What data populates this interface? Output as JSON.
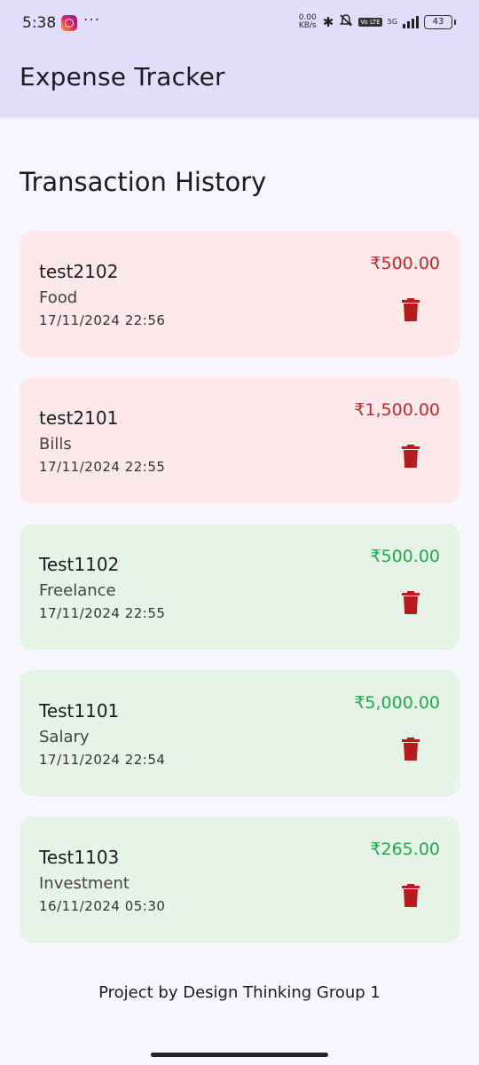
{
  "status_bar": {
    "time": "5:38",
    "dots": "···",
    "net_speed_value": "0.00",
    "net_speed_unit": "KB/s",
    "volte": "Vo LTE",
    "network": "5G",
    "battery": "43"
  },
  "app_bar": {
    "title": "Expense Tracker"
  },
  "main": {
    "section_title": "Transaction History",
    "transactions": [
      {
        "description": "test2102",
        "category": "Food",
        "date": "17/11/2024 22:56",
        "amount": "₹500.00",
        "type": "expense"
      },
      {
        "description": "test2101",
        "category": "Bills",
        "date": "17/11/2024 22:55",
        "amount": "₹1,500.00",
        "type": "expense"
      },
      {
        "description": "Test1102",
        "category": "Freelance",
        "date": "17/11/2024 22:55",
        "amount": "₹500.00",
        "type": "income"
      },
      {
        "description": "Test1101",
        "category": "Salary",
        "date": "17/11/2024 22:54",
        "amount": "₹5,000.00",
        "type": "income"
      },
      {
        "description": "Test1103",
        "category": "Investment",
        "date": "16/11/2024 05:30",
        "amount": "₹265.00",
        "type": "income"
      }
    ]
  },
  "footer": {
    "text": "Project by Design Thinking Group 1"
  },
  "colors": {
    "app_bar": "#e0defa",
    "expense_card": "#fde8ea",
    "income_card": "#e6f4e7",
    "expense_amount": "#c62828",
    "income_amount": "#1faa4b",
    "delete_icon": "#b71c1c"
  }
}
